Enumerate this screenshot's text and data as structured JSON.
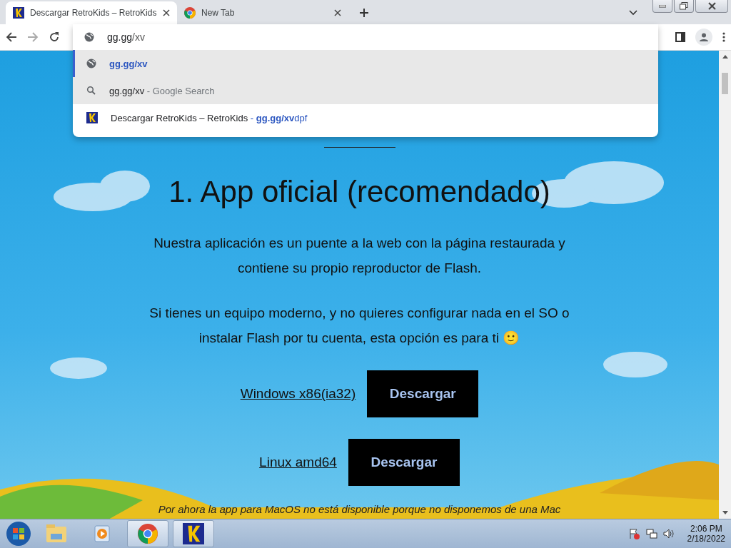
{
  "tabs": [
    {
      "kind": "site",
      "title": "Descargar RetroKids – RetroKids",
      "selected": true
    },
    {
      "kind": "chrome",
      "title": "New Tab",
      "selected": false
    }
  ],
  "omnibox": {
    "typed": "gg.gg",
    "completion": "/xv"
  },
  "suggestions": [
    {
      "kind": "globe",
      "text": "**gg.gg/xv**",
      "selected": true,
      "hovered": false
    },
    {
      "kind": "search",
      "text": "gg.gg/xv",
      "suffix": " - Google Search",
      "selected": false,
      "hovered": true
    },
    {
      "kind": "site",
      "text": "Descargar RetroKids – RetroKids",
      "suffix": " - **gg.gg/xv**dpf",
      "selected": false,
      "hovered": false
    }
  ],
  "page": {
    "heading": "1. App oficial (recomendado)",
    "paragraphs": [
      "Nuestra aplicación es un puente a la web con la página restaurada y contiene su propio reproductor de Flash.",
      "Si tienes un equipo moderno, y no quieres configurar nada en el SO o instalar Flash por tu cuenta, esta opción es para ti 🙂"
    ],
    "downloads": [
      {
        "link": "Windows x86(ia32)",
        "button": "Descargar"
      },
      {
        "link": "Linux amd64",
        "button": "Descargar"
      }
    ],
    "footnote": "Por ahora la app para MacOS no está disponible porque no disponemos de una Mac"
  },
  "taskbar": {
    "apps": [
      {
        "kind": "explorer",
        "active": false
      },
      {
        "kind": "media",
        "active": false
      },
      {
        "kind": "chrome",
        "active": true
      },
      {
        "kind": "retrokids",
        "active": true
      }
    ],
    "time": "2:06 PM",
    "date": "2/18/2022"
  }
}
